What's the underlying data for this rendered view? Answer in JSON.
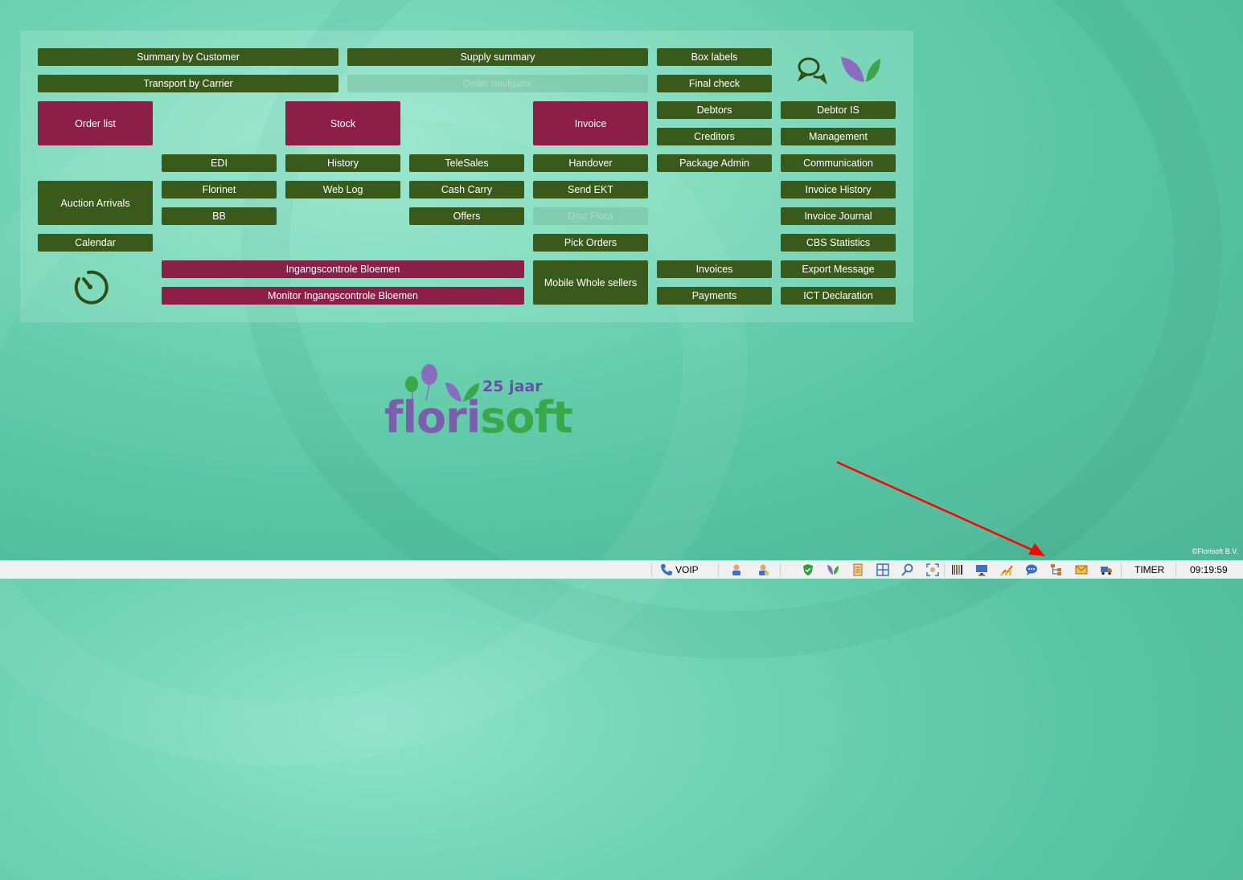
{
  "buttons": {
    "summary_by_customer": "Summary by Customer",
    "supply_summary": "Supply summary",
    "box_labels": "Box labels",
    "transport_by_carrier": "Transport by Carrier",
    "order_navigator": "Order navigator",
    "final_check": "Final check",
    "order_list": "Order list",
    "stock": "Stock",
    "invoice": "Invoice",
    "debtors": "Debtors",
    "debtor_is": "Debtor IS",
    "creditors": "Creditors",
    "management": "Management",
    "edi": "EDI",
    "history": "History",
    "telesales": "TeleSales",
    "handover": "Handover",
    "package_admin": "Package Admin",
    "communication": "Communication",
    "auction_arrivals": "Auction Arrivals",
    "florinet": "Florinet",
    "web_log": "Web Log",
    "cash_carry": "Cash Carry",
    "send_ekt": "Send EKT",
    "invoice_history": "Invoice History",
    "bb": "BB",
    "offers": "Offers",
    "disc_flora": "Disc Flora",
    "invoice_journal": "Invoice Journal",
    "calendar": "Calendar",
    "pick_orders": "Pick Orders",
    "cbs_statistics": "CBS Statistics",
    "ingangscontrole_bloemen": "Ingangscontrole Bloemen",
    "mobile_whole_sellers": "Mobile Whole sellers",
    "invoices": "Invoices",
    "export_message": "Export Message",
    "monitor_ingangscontrole_bloemen": "Monitor Ingangscontrole Bloemen",
    "payments": "Payments",
    "ict_declaration": "ICT Declaration"
  },
  "logo": {
    "anniversary": "25 jaar",
    "brand_part1": "flori",
    "brand_part2": "soft"
  },
  "copyright": "©Florisoft B.V.",
  "taskbar": {
    "voip_label": "VOIP",
    "timer_label": "TIMER",
    "clock": "09:19:59",
    "icons": [
      "user-icon",
      "user-admin-icon",
      "shield-icon",
      "florisoft-leaf-icon",
      "document-icon",
      "grid-icon",
      "search-icon",
      "scan-icon",
      "barcode-icon",
      "monitor-icon",
      "chart-icon",
      "chat-icon",
      "tree-icon",
      "mail-icon",
      "truck-icon"
    ]
  },
  "colors": {
    "green_button": "#3a5a1c",
    "red_button": "#8b1f48",
    "background": "#6fd3b3",
    "annotation_arrow": "#ff0000"
  }
}
